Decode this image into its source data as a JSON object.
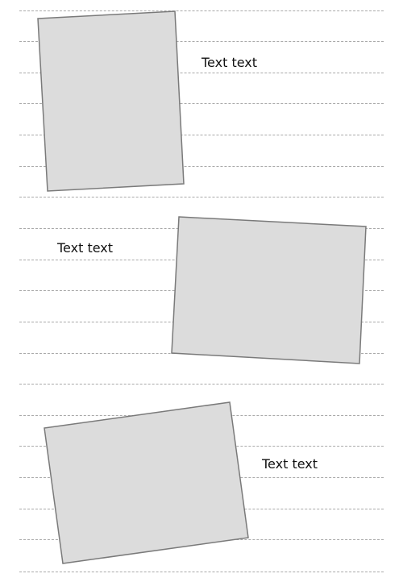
{
  "colors": {
    "card_fill": "#dcdcdc",
    "card_border": "#7a7a7a",
    "rule_line": "#a9a9a9",
    "text": "#111111",
    "background": "#ffffff"
  },
  "items": [
    {
      "caption": "Text text"
    },
    {
      "caption": "Text text"
    },
    {
      "caption": "Text text"
    }
  ]
}
